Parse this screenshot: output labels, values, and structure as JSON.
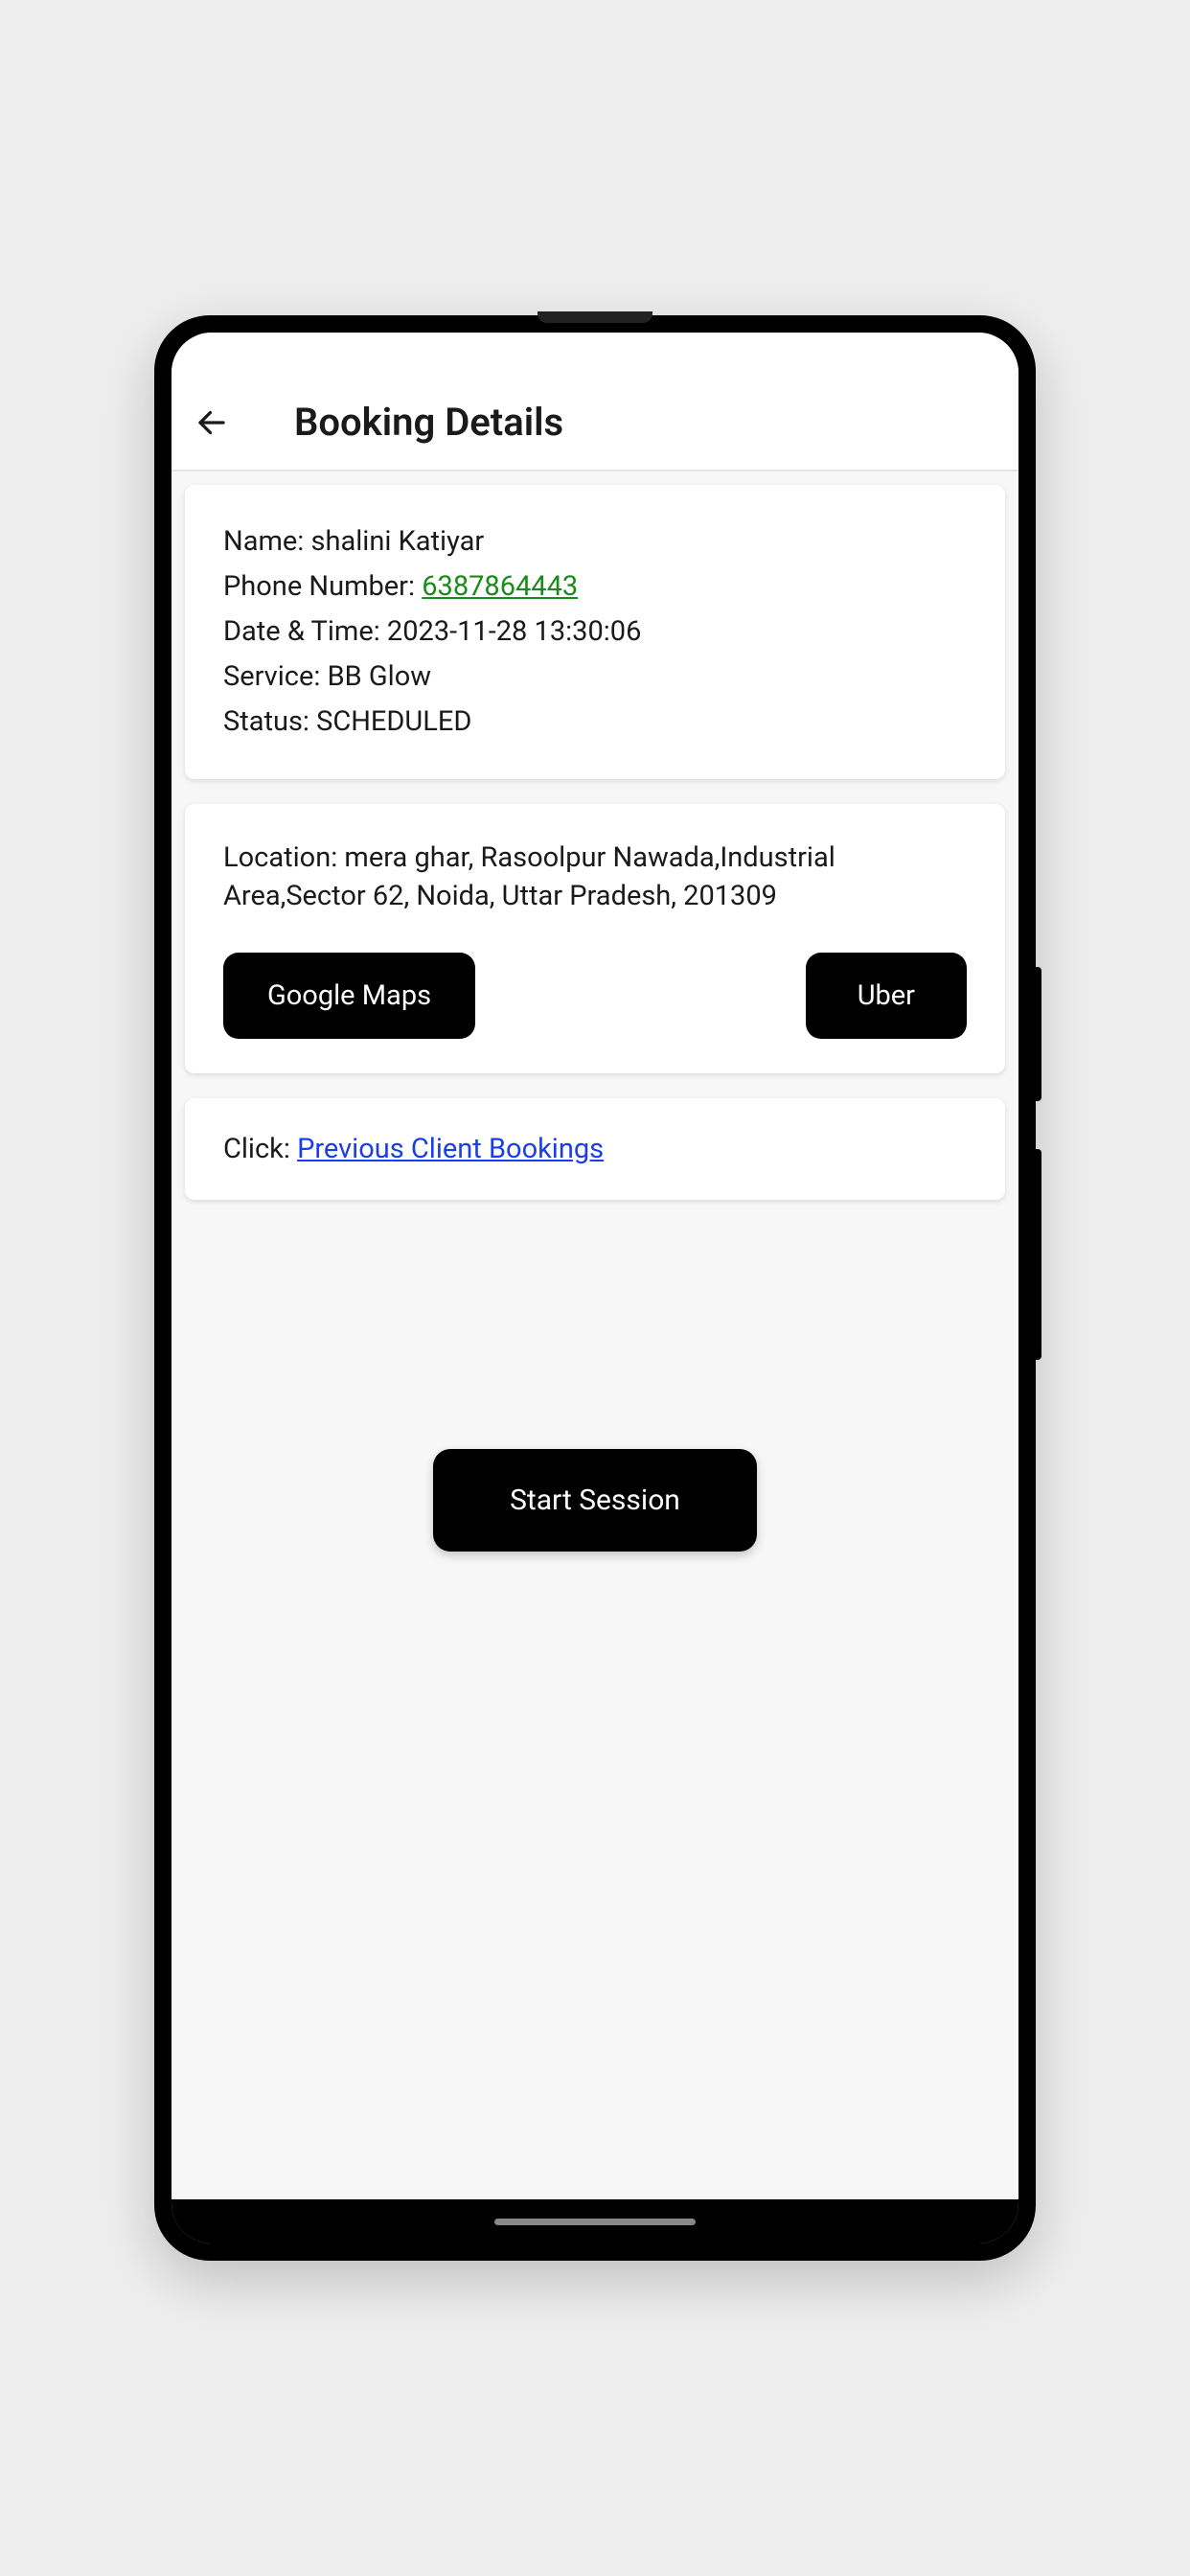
{
  "header": {
    "title": "Booking Details"
  },
  "details": {
    "name_label": "Name: ",
    "name_value": "shalini Katiyar",
    "phone_label": "Phone Number: ",
    "phone_value": "6387864443",
    "datetime_label": "Date & Time: ",
    "datetime_value": "2023-11-28 13:30:06",
    "service_label": "Service: ",
    "service_value": "BB Glow",
    "status_label": "Status: ",
    "status_value": "SCHEDULED"
  },
  "location": {
    "label": "Location: ",
    "value": "mera ghar, Rasoolpur Nawada,Industrial Area,Sector 62, Noida, Uttar Pradesh, 201309",
    "google_maps_button": "Google Maps",
    "uber_button": "Uber"
  },
  "previous": {
    "click_label": "Click: ",
    "link_text": "Previous Client Bookings"
  },
  "actions": {
    "start_session": "Start Session"
  }
}
